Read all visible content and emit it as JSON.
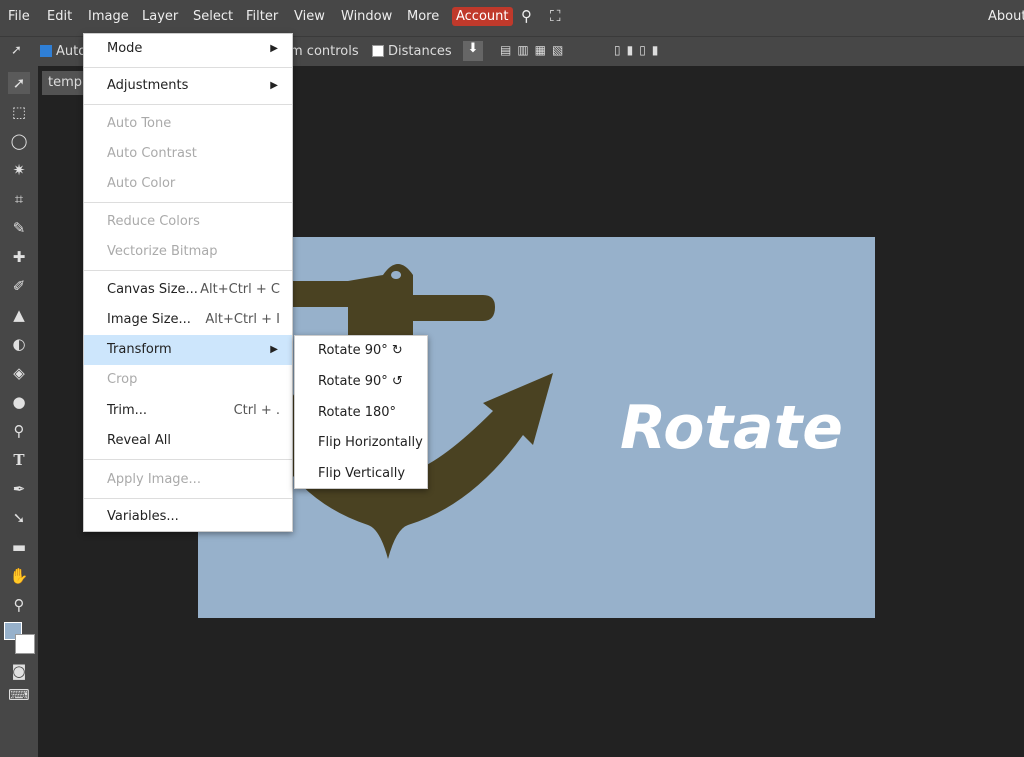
{
  "menubar": {
    "file": "File",
    "edit": "Edit",
    "image": "Image",
    "layer": "Layer",
    "select": "Select",
    "filter": "Filter",
    "view": "View",
    "window": "Window",
    "more": "More",
    "account": "Account",
    "about": "About"
  },
  "options": {
    "auto": "Auto",
    "transform": "m controls",
    "distances": "Distances"
  },
  "doc_tab": "templ",
  "canvas_text": "Rotate",
  "image_menu": {
    "mode": "Mode",
    "adjustments": "Adjustments",
    "auto_tone": "Auto Tone",
    "auto_contrast": "Auto Contrast",
    "auto_color": "Auto Color",
    "reduce_colors": "Reduce Colors",
    "vectorize": "Vectorize Bitmap",
    "canvas_size": "Canvas Size...",
    "canvas_sc": "Alt+Ctrl + C",
    "image_size": "Image Size...",
    "image_sc": "Alt+Ctrl + I",
    "transform": "Transform",
    "crop": "Crop",
    "trim": "Trim...",
    "trim_sc": "Ctrl + .",
    "reveal": "Reveal All",
    "apply": "Apply Image...",
    "variables": "Variables..."
  },
  "transform_menu": {
    "r90cw": "Rotate 90° ↻",
    "r90ccw": "Rotate 90° ↺",
    "r180": "Rotate 180°",
    "fliph": "Flip Horizontally",
    "flipv": "Flip Vertically"
  }
}
